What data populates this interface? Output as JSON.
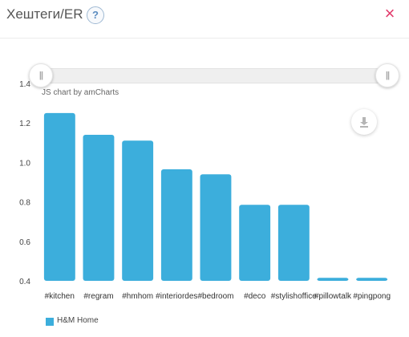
{
  "header": {
    "title": "Хештеги/ER",
    "help_label": "?",
    "close_label": "×"
  },
  "chart_meta": {
    "credit": "JS chart by amCharts",
    "bar_color": "#3caedc",
    "close_color": "#e23a6b",
    "download_icon": "download-icon",
    "scrollbar_grip_label": "||"
  },
  "chart_data": {
    "type": "bar",
    "categories": [
      "#kitchen",
      "#regram",
      "#hmhome",
      "#interiordesign",
      "#bedroom",
      "#deco",
      "#stylishoffice",
      "#pillowtalk",
      "#pingpong"
    ],
    "category_labels": [
      "#kitchen",
      "#regram",
      "#hmhom",
      "#interiordes",
      "#bedroom",
      "#deco",
      "#stylishoffice",
      "#pillowtalk",
      "#pingpong"
    ],
    "series": [
      {
        "name": "H&M Home",
        "values": [
          1.25,
          1.14,
          1.11,
          0.965,
          0.94,
          0.785,
          0.785,
          0.415,
          0.415
        ]
      }
    ],
    "yticks": [
      "0.4",
      "0.6",
      "0.8",
      "1.0",
      "1.2",
      "1.4"
    ],
    "ylim": [
      0.4,
      1.4
    ],
    "title": "",
    "xlabel": "",
    "ylabel": "",
    "grid": false,
    "legend": "bottom-left"
  }
}
